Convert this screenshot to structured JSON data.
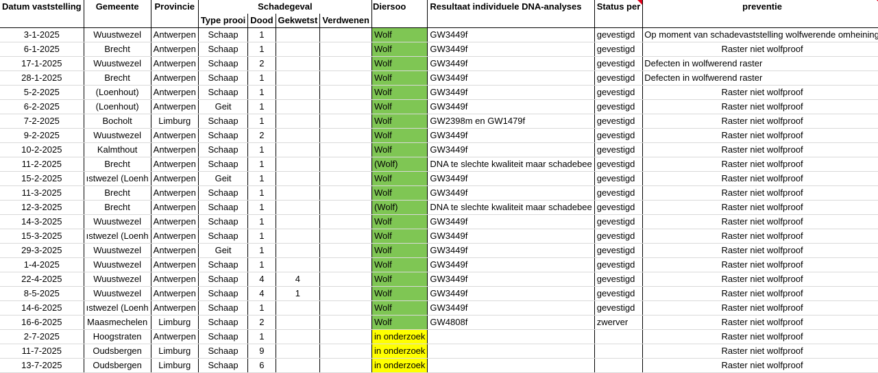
{
  "headers": {
    "datum": "Datum vaststelling",
    "gemeente": "Gemeente",
    "provincie": "Provincie",
    "schadegeval": "Schadegeval",
    "diersoort": "Diersoo",
    "resultaat": "Resultaat individuele DNA-analyses",
    "status": "Status per",
    "preventie": "preventie",
    "type_prooi": "Type prooi",
    "dood": "Dood",
    "gekwetst": "Gekwetst",
    "verdwenen": "Verdwenen"
  },
  "rows": [
    {
      "datum": "3-1-2025",
      "gemeente": "Wuustwezel",
      "provincie": "Antwerpen",
      "type": "Schaap",
      "dood": "1",
      "gekwetst": "",
      "verdwenen": "",
      "soort": "Wolf",
      "soort_kleur": "wolf",
      "resultaat": "GW3449f",
      "status": "gevestigd",
      "preventie": "Op moment van schadevaststelling wolfwerende omheining",
      "prev_align": "left"
    },
    {
      "datum": "6-1-2025",
      "gemeente": "Brecht",
      "provincie": "Antwerpen",
      "type": "Schaap",
      "dood": "1",
      "gekwetst": "",
      "verdwenen": "",
      "soort": "Wolf",
      "soort_kleur": "wolf",
      "resultaat": "GW3449f",
      "status": "gevestigd",
      "preventie": "Raster niet wolfproof",
      "prev_align": "center"
    },
    {
      "datum": "17-1-2025",
      "gemeente": "Wuustwezel",
      "provincie": "Antwerpen",
      "type": "Schaap",
      "dood": "2",
      "gekwetst": "",
      "verdwenen": "",
      "soort": "Wolf",
      "soort_kleur": "wolf",
      "resultaat": "GW3449f",
      "status": "gevestigd",
      "preventie": "Defecten in wolfwerend raster",
      "prev_align": "left"
    },
    {
      "datum": "28-1-2025",
      "gemeente": "Brecht",
      "provincie": "Antwerpen",
      "type": "Schaap",
      "dood": "1",
      "gekwetst": "",
      "verdwenen": "",
      "soort": "Wolf",
      "soort_kleur": "wolf",
      "resultaat": "GW3449f",
      "status": "gevestigd",
      "preventie": "Defecten in wolfwerend raster",
      "prev_align": "left"
    },
    {
      "datum": "5-2-2025",
      "gemeente": "(Loenhout)",
      "provincie": "Antwerpen",
      "type": "Schaap",
      "dood": "1",
      "gekwetst": "",
      "verdwenen": "",
      "soort": "Wolf",
      "soort_kleur": "wolf",
      "resultaat": "GW3449f",
      "status": "gevestigd",
      "preventie": "Raster niet wolfproof",
      "prev_align": "center"
    },
    {
      "datum": "6-2-2025",
      "gemeente": "(Loenhout)",
      "provincie": "Antwerpen",
      "type": "Geit",
      "dood": "1",
      "gekwetst": "",
      "verdwenen": "",
      "soort": "Wolf",
      "soort_kleur": "wolf",
      "resultaat": "GW3449f",
      "status": "gevestigd",
      "preventie": "Raster niet wolfproof",
      "prev_align": "center"
    },
    {
      "datum": "7-2-2025",
      "gemeente": "Bocholt",
      "provincie": "Limburg",
      "type": "Schaap",
      "dood": "1",
      "gekwetst": "",
      "verdwenen": "",
      "soort": "Wolf",
      "soort_kleur": "wolf",
      "resultaat": "GW2398m en GW1479f",
      "status": "gevestigd",
      "preventie": "Raster niet wolfproof",
      "prev_align": "center"
    },
    {
      "datum": "9-2-2025",
      "gemeente": "Wuustwezel",
      "provincie": "Antwerpen",
      "type": "Schaap",
      "dood": "2",
      "gekwetst": "",
      "verdwenen": "",
      "soort": "Wolf",
      "soort_kleur": "wolf",
      "resultaat": "GW3449f",
      "status": "gevestigd",
      "preventie": "Raster niet wolfproof",
      "prev_align": "center"
    },
    {
      "datum": "10-2-2025",
      "gemeente": "Kalmthout",
      "provincie": "Antwerpen",
      "type": "Schaap",
      "dood": "1",
      "gekwetst": "",
      "verdwenen": "",
      "soort": "Wolf",
      "soort_kleur": "wolf",
      "resultaat": "GW3449f",
      "status": "gevestigd",
      "preventie": "Raster niet wolfproof",
      "prev_align": "center"
    },
    {
      "datum": "11-2-2025",
      "gemeente": "Brecht",
      "provincie": "Antwerpen",
      "type": "Schaap",
      "dood": "1",
      "gekwetst": "",
      "verdwenen": "",
      "soort": "(Wolf)",
      "soort_kleur": "wolf",
      "resultaat": "DNA te slechte kwaliteit maar schadebee",
      "status": "gevestigd",
      "preventie": "Raster niet wolfproof",
      "prev_align": "center"
    },
    {
      "datum": "15-2-2025",
      "gemeente": "ıstwezel (Loenh",
      "provincie": "Antwerpen",
      "type": "Geit",
      "dood": "1",
      "gekwetst": "",
      "verdwenen": "",
      "soort": "Wolf",
      "soort_kleur": "wolf",
      "resultaat": "GW3449f",
      "status": "gevestigd",
      "preventie": "Raster niet wolfproof",
      "prev_align": "center"
    },
    {
      "datum": "11-3-2025",
      "gemeente": "Brecht",
      "provincie": "Antwerpen",
      "type": "Schaap",
      "dood": "1",
      "gekwetst": "",
      "verdwenen": "",
      "soort": "Wolf",
      "soort_kleur": "wolf",
      "resultaat": "GW3449f",
      "status": "gevestigd",
      "preventie": "Raster niet wolfproof",
      "prev_align": "center"
    },
    {
      "datum": "12-3-2025",
      "gemeente": "Brecht",
      "provincie": "Antwerpen",
      "type": "Schaap",
      "dood": "1",
      "gekwetst": "",
      "verdwenen": "",
      "soort": "(Wolf)",
      "soort_kleur": "wolf",
      "resultaat": "DNA te slechte kwaliteit maar schadebee",
      "status": "gevestigd",
      "preventie": "Raster niet wolfproof",
      "prev_align": "center"
    },
    {
      "datum": "14-3-2025",
      "gemeente": "Wuustwezel",
      "provincie": "Antwerpen",
      "type": "Schaap",
      "dood": "1",
      "gekwetst": "",
      "verdwenen": "",
      "soort": "Wolf",
      "soort_kleur": "wolf",
      "resultaat": "GW3449f",
      "status": "gevestigd",
      "preventie": "Raster niet wolfproof",
      "prev_align": "center"
    },
    {
      "datum": "15-3-2025",
      "gemeente": "ıstwezel (Loenh",
      "provincie": "Antwerpen",
      "type": "Schaap",
      "dood": "1",
      "gekwetst": "",
      "verdwenen": "",
      "soort": "Wolf",
      "soort_kleur": "wolf",
      "resultaat": "GW3449f",
      "status": "gevestigd",
      "preventie": "Raster niet wolfproof",
      "prev_align": "center"
    },
    {
      "datum": "29-3-2025",
      "gemeente": "Wuustwezel",
      "provincie": "Antwerpen",
      "type": "Geit",
      "dood": "1",
      "gekwetst": "",
      "verdwenen": "",
      "soort": "Wolf",
      "soort_kleur": "wolf",
      "resultaat": "GW3449f",
      "status": "gevestigd",
      "preventie": "Raster niet wolfproof",
      "prev_align": "center"
    },
    {
      "datum": "1-4-2025",
      "gemeente": "Wuustwezel",
      "provincie": "Antwerpen",
      "type": "Schaap",
      "dood": "1",
      "gekwetst": "",
      "verdwenen": "",
      "soort": "Wolf",
      "soort_kleur": "wolf",
      "resultaat": "GW3449f",
      "status": "gevestigd",
      "preventie": "Raster niet wolfproof",
      "prev_align": "center"
    },
    {
      "datum": "22-4-2025",
      "gemeente": "Wuustwezel",
      "provincie": "Antwerpen",
      "type": "Schaap",
      "dood": "4",
      "gekwetst": "4",
      "verdwenen": "",
      "soort": "Wolf",
      "soort_kleur": "wolf",
      "resultaat": "GW3449f",
      "status": "gevestigd",
      "preventie": "Raster niet wolfproof",
      "prev_align": "center"
    },
    {
      "datum": "8-5-2025",
      "gemeente": "Wuustwezel",
      "provincie": "Antwerpen",
      "type": "Schaap",
      "dood": "4",
      "gekwetst": "1",
      "verdwenen": "",
      "soort": "Wolf",
      "soort_kleur": "wolf",
      "resultaat": "GW3449f",
      "status": "gevestigd",
      "preventie": "Raster niet wolfproof",
      "prev_align": "center"
    },
    {
      "datum": "14-6-2025",
      "gemeente": "ıstwezel (Loenh",
      "provincie": "Antwerpen",
      "type": "Schaap",
      "dood": "1",
      "gekwetst": "",
      "verdwenen": "",
      "soort": "Wolf",
      "soort_kleur": "wolf",
      "resultaat": "GW3449f",
      "status": "gevestigd",
      "preventie": "Raster niet wolfproof",
      "prev_align": "center"
    },
    {
      "datum": "16-6-2025",
      "gemeente": "Maasmechelen",
      "provincie": "Limburg",
      "type": "Schaap",
      "dood": "2",
      "gekwetst": "",
      "verdwenen": "",
      "soort": "Wolf",
      "soort_kleur": "wolf",
      "resultaat": "GW4808f",
      "status": "zwerver",
      "preventie": "Raster niet wolfproof",
      "prev_align": "center"
    },
    {
      "datum": "2-7-2025",
      "gemeente": "Hoogstraten",
      "provincie": "Antwerpen",
      "type": "Schaap",
      "dood": "1",
      "gekwetst": "",
      "verdwenen": "",
      "soort": "in onderzoek",
      "soort_kleur": "onderzoek",
      "resultaat": "",
      "status": "",
      "preventie": "Raster niet wolfproof",
      "prev_align": "center"
    },
    {
      "datum": "11-7-2025",
      "gemeente": "Oudsbergen",
      "provincie": "Limburg",
      "type": "Schaap",
      "dood": "9",
      "gekwetst": "",
      "verdwenen": "",
      "soort": "in onderzoek",
      "soort_kleur": "onderzoek",
      "resultaat": "",
      "status": "",
      "preventie": "Raster niet wolfproof",
      "prev_align": "center"
    },
    {
      "datum": "13-7-2025",
      "gemeente": "Oudsbergen",
      "provincie": "Limburg",
      "type": "Schaap",
      "dood": "6",
      "gekwetst": "",
      "verdwenen": "",
      "soort": "in onderzoek",
      "soort_kleur": "onderzoek",
      "resultaat": "",
      "status": "",
      "preventie": "Raster niet wolfproof",
      "prev_align": "center"
    }
  ],
  "colors": {
    "wolf": "#7fc654",
    "onderzoek": "#ffff00",
    "comment_flag": "#e0001b"
  }
}
